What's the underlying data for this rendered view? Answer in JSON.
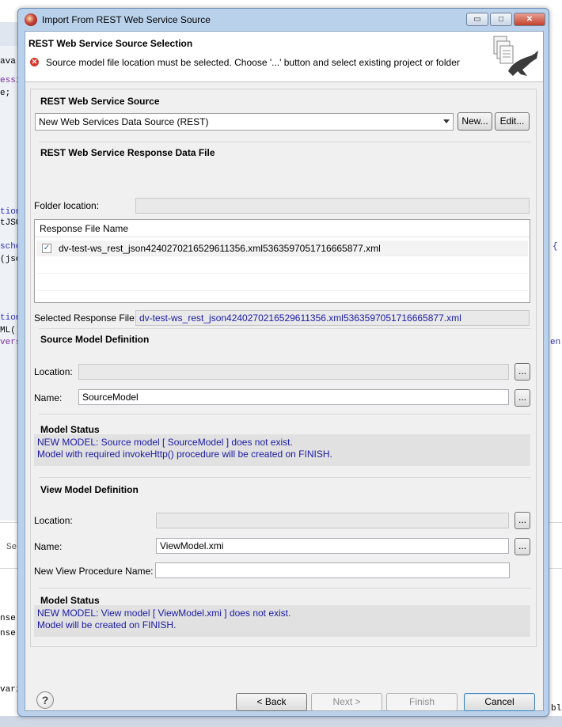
{
  "window": {
    "title": "Import From REST Web Service Source"
  },
  "banner": {
    "title": "REST Web Service Source Selection",
    "error_message": "Source model file location must be selected. Choose '...' button and select existing project or folder"
  },
  "background": {
    "code_lines": [
      "ava",
      "essi",
      "e;",
      "tion",
      "tJSO",
      "sche",
      "(jso",
      "tion",
      "ML()",
      "vers"
    ],
    "bottom_lines": [
      "nse",
      "nse",
      "varia"
    ],
    "right_fragments": [
      "{",
      "en",
      "ble"
    ],
    "mini_tab": "Se"
  },
  "rest_source": {
    "title": "REST Web Service Source",
    "selected": "New Web Services Data Source (REST)",
    "new_button": "New...",
    "edit_button": "Edit..."
  },
  "response_file": {
    "title": "REST Web Service Response Data File",
    "folder_label": "Folder location:",
    "folder_value": "",
    "column_header": "Response File Name",
    "rows": [
      {
        "checked": true,
        "name": "dv-test-ws_rest_json4240270216529611356.xml5363597051716665877.xml"
      }
    ],
    "selected_label": "Selected Response File:",
    "selected_value": "dv-test-ws_rest_json4240270216529611356.xml5363597051716665877.xml"
  },
  "source_model": {
    "title": "Source Model Definition",
    "location_label": "Location:",
    "location_value": "",
    "name_label": "Name:",
    "name_value": "SourceModel",
    "browse_label": "..."
  },
  "source_status": {
    "title": "Model Status",
    "line1": "NEW MODEL: Source model [ SourceModel ] does not exist.",
    "line2": "Model with required invokeHttp() procedure will be created on FINISH."
  },
  "view_model": {
    "title": "View Model Definition",
    "location_label": "Location:",
    "location_value": "",
    "name_label": "Name:",
    "name_value": "ViewModel.xmi",
    "proc_label": "New View Procedure Name:",
    "proc_value": "",
    "browse_label": "..."
  },
  "view_status": {
    "title": "Model Status",
    "line1": "NEW MODEL: View model [ ViewModel.xmi ] does not exist.",
    "line2": "Model will be created on FINISH."
  },
  "footer": {
    "help": "?",
    "back": "< Back",
    "next": "Next >",
    "finish": "Finish",
    "cancel": "Cancel"
  },
  "window_buttons": {
    "minimize": "▭",
    "maximize": "□",
    "close": "✕"
  }
}
